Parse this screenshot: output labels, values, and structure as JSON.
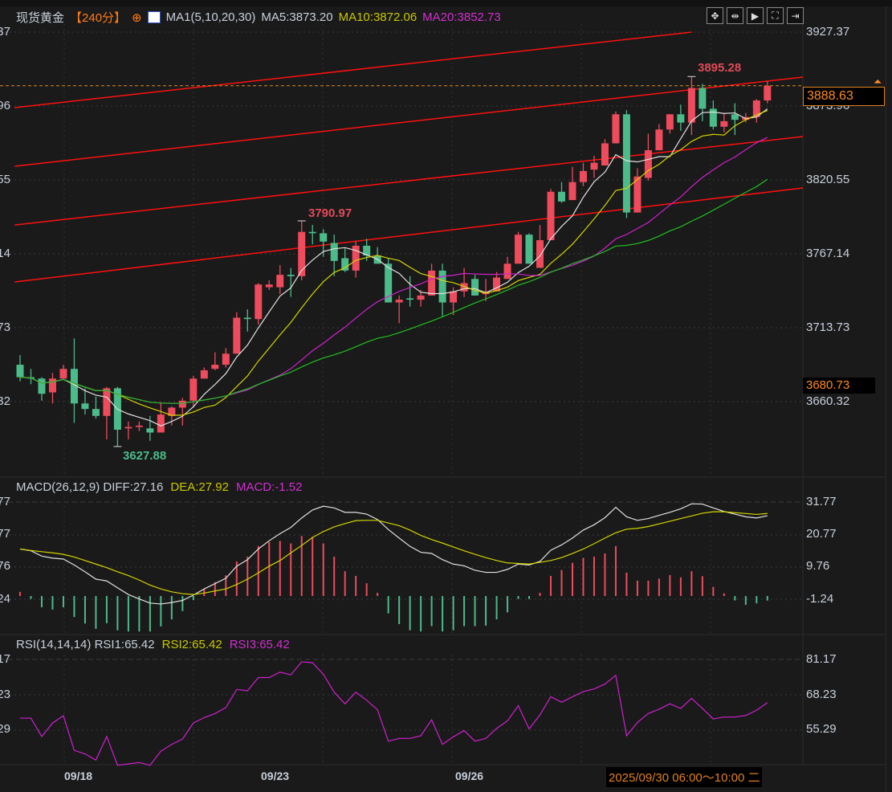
{
  "header": {
    "symbol": "现货黄金",
    "period": "【240分】",
    "ma_label": "MA1(5,10,20,30)",
    "ma5": "MA5:3873.20",
    "ma10": "MA10:3872.06",
    "ma20": "MA20:3852.73"
  },
  "toolbar": [
    {
      "icon": "crosshair-icon",
      "glyph": "✥"
    },
    {
      "icon": "range-icon",
      "glyph": "⇹"
    },
    {
      "icon": "play-icon",
      "glyph": "▶"
    },
    {
      "icon": "fullscreen-icon",
      "glyph": "⛶"
    },
    {
      "icon": "exit-icon",
      "glyph": "⇥"
    }
  ],
  "price_axis": [
    "3927.37",
    "3873.96",
    "3820.55",
    "3767.14",
    "3713.73",
    "3660.32"
  ],
  "current_price": "3888.63",
  "marker_price": "3680.73",
  "annotations": {
    "high": "3895.28",
    "mid_high": "3790.97",
    "low": "3627.88"
  },
  "macd": {
    "title": "MACD(26,12,9)",
    "diff": "DIFF:27.16",
    "dea": "DEA:27.92",
    "macd": "MACD:-1.52",
    "axis": [
      "31.77",
      "20.77",
      "9.76",
      "-1.24"
    ]
  },
  "rsi": {
    "title": "RSI(14,14,14)",
    "rsi1": "RSI1:65.42",
    "rsi2": "RSI2:65.42",
    "rsi3": "RSI3:65.42",
    "axis": [
      "81.17",
      "68.23",
      "55.29"
    ]
  },
  "x_axis": {
    "dates": [
      "09/18",
      "09/23",
      "09/26"
    ],
    "cursor_time": "2025/09/30 06:00～10:00 二"
  },
  "colors": {
    "up": "#ee4b5c",
    "down": "#4cbb8a",
    "trend": "#ff1010",
    "ma5": "#e0e0e0",
    "ma10": "#d4d400",
    "ma20": "#d020d0",
    "ma30": "#20c020",
    "dif": "#e0e0e0",
    "dea": "#d4d400",
    "rsi": "#d020d0"
  },
  "chart_data": {
    "type": "candlestick",
    "title": "现货黄金 240分",
    "ylim": [
      3605,
      3940
    ],
    "candles_ohlc": [
      [
        3687,
        3694,
        3675,
        3678
      ],
      [
        3678,
        3684,
        3673,
        3677
      ],
      [
        3677,
        3678,
        3661,
        3666
      ],
      [
        3667,
        3681,
        3659,
        3677
      ],
      [
        3677,
        3687,
        3677,
        3684
      ],
      [
        3684,
        3706,
        3645,
        3659
      ],
      [
        3659,
        3670,
        3651,
        3655
      ],
      [
        3655,
        3664,
        3648,
        3650
      ],
      [
        3650,
        3671,
        3633,
        3670
      ],
      [
        3670,
        3671,
        3627.88,
        3640
      ],
      [
        3641,
        3646,
        3633,
        3642
      ],
      [
        3642,
        3646,
        3639,
        3643
      ],
      [
        3641,
        3650,
        3632,
        3638
      ],
      [
        3638,
        3660,
        3638,
        3651
      ],
      [
        3650,
        3657,
        3643,
        3656
      ],
      [
        3656,
        3663,
        3643,
        3661
      ],
      [
        3661,
        3679,
        3656,
        3677
      ],
      [
        3677,
        3685,
        3677,
        3683
      ],
      [
        3684,
        3696,
        3683,
        3687
      ],
      [
        3687,
        3699,
        3685,
        3695
      ],
      [
        3695,
        3725,
        3695,
        3721
      ],
      [
        3721,
        3727,
        3711,
        3720
      ],
      [
        3720,
        3746,
        3716,
        3745
      ],
      [
        3743,
        3748,
        3741,
        3745
      ],
      [
        3743,
        3759,
        3738,
        3752
      ],
      [
        3752,
        3757,
        3736,
        3751
      ],
      [
        3751,
        3790.97,
        3748,
        3783
      ],
      [
        3783,
        3788,
        3774,
        3782
      ],
      [
        3782,
        3785,
        3765,
        3776
      ],
      [
        3775,
        3781,
        3751,
        3762
      ],
      [
        3764,
        3771,
        3754,
        3755
      ],
      [
        3755,
        3776,
        3750,
        3773
      ],
      [
        3773,
        3778,
        3762,
        3766
      ],
      [
        3766,
        3772,
        3760,
        3760
      ],
      [
        3760,
        3764,
        3732,
        3732
      ],
      [
        3732,
        3737,
        3717,
        3734
      ],
      [
        3735,
        3751,
        3729,
        3734
      ],
      [
        3734,
        3741,
        3729,
        3737
      ],
      [
        3737,
        3760,
        3737,
        3755
      ],
      [
        3755,
        3760,
        3722,
        3732
      ],
      [
        3732,
        3743,
        3723,
        3740
      ],
      [
        3740,
        3757,
        3736,
        3746
      ],
      [
        3749,
        3752,
        3737,
        3737
      ],
      [
        3738,
        3749,
        3733,
        3740
      ],
      [
        3740,
        3754,
        3740,
        3750
      ],
      [
        3749,
        3765,
        3749,
        3760
      ],
      [
        3760,
        3783,
        3760,
        3781
      ],
      [
        3781,
        3782,
        3760,
        3760
      ],
      [
        3757,
        3788,
        3757,
        3777
      ],
      [
        3777,
        3814,
        3777,
        3812
      ],
      [
        3812,
        3819,
        3804,
        3805
      ],
      [
        3806,
        3830,
        3806,
        3819
      ],
      [
        3819,
        3833,
        3816,
        3827
      ],
      [
        3828,
        3838,
        3822,
        3833
      ],
      [
        3831,
        3850,
        3831,
        3847
      ],
      [
        3847,
        3870,
        3847,
        3868
      ],
      [
        3868,
        3871,
        3793,
        3797
      ],
      [
        3797,
        3829,
        3797,
        3823
      ],
      [
        3822,
        3854,
        3820,
        3842
      ],
      [
        3842,
        3861,
        3842,
        3857
      ],
      [
        3857,
        3868,
        3854,
        3868
      ],
      [
        3868,
        3875,
        3856,
        3862
      ],
      [
        3862,
        3895.28,
        3853,
        3887
      ],
      [
        3887,
        3890,
        3863,
        3872
      ],
      [
        3872,
        3878,
        3857,
        3859
      ],
      [
        3859,
        3869,
        3855,
        3863
      ],
      [
        3868,
        3876,
        3853,
        3864
      ],
      [
        3864,
        3869,
        3862,
        3866
      ],
      [
        3866,
        3879,
        3862,
        3878
      ],
      [
        3878,
        3892,
        3876,
        3888.63
      ]
    ],
    "ma_periods": [
      5,
      10,
      20,
      30
    ],
    "trendlines": [
      [
        [
          -0.5,
          3872.8
        ],
        [
          62,
          3927.37
        ]
      ],
      [
        [
          -0.5,
          3830.4
        ],
        [
          72.3,
          3894.9
        ]
      ],
      [
        [
          -0.5,
          3788.0
        ],
        [
          72.3,
          3851.9
        ]
      ],
      [
        [
          -0.5,
          3746.8
        ],
        [
          72.3,
          3814.8
        ]
      ]
    ],
    "macd_hist": [
      1.4,
      -1.0,
      -3.8,
      -4.6,
      -3.8,
      -7.1,
      -9.3,
      -11.1,
      -9.2,
      -11.6,
      -12,
      -12,
      -12,
      -10.3,
      -7.9,
      -5.1,
      -1.4,
      2.3,
      4.7,
      7.0,
      11.7,
      13.3,
      16.9,
      18.3,
      18.6,
      17.8,
      20.3,
      20.0,
      17.8,
      13.3,
      8.4,
      6.8,
      4.3,
      1.1,
      -5.9,
      -9.5,
      -11.6,
      -12.0,
      -10.2,
      -12.0,
      -11.6,
      -10.2,
      -10.2,
      -10.0,
      -7.9,
      -5.5,
      -1.0,
      -1.0,
      1.1,
      6.8,
      8.8,
      11.2,
      12.9,
      13.3,
      14.4,
      16.9,
      7.9,
      5.2,
      5.2,
      5.9,
      7.1,
      6.3,
      8.4,
      6.7,
      3.1,
      0.9,
      -1.5,
      -3.0,
      -2.5,
      -1.52
    ],
    "diff": [
      15.9,
      15.3,
      13.5,
      12.8,
      12.5,
      10.5,
      8.2,
      5.7,
      5.1,
      2.8,
      0.5,
      -1.0,
      -2.4,
      -2.7,
      -2.2,
      -1.5,
      0.3,
      2.4,
      4.2,
      6.0,
      10.1,
      12.3,
      15.9,
      18.7,
      21.1,
      23.2,
      26.4,
      29.1,
      30.4,
      29.8,
      28.3,
      28.3,
      27.7,
      25.9,
      22.5,
      19.6,
      16.8,
      14.8,
      14.4,
      12.3,
      10.8,
      10.2,
      8.7,
      8.0,
      8.0,
      9.0,
      10.8,
      10.5,
      11.7,
      15.5,
      17.3,
      19.6,
      22.3,
      24.1,
      26.5,
      30.0,
      26.8,
      25.6,
      26.2,
      27.3,
      28.3,
      29.5,
      31.2,
      31.1,
      29.8,
      28.6,
      27.7,
      26.8,
      26.4,
      27.16
    ],
    "dea": [
      15.9,
      15.4,
      15.0,
      14.6,
      14.1,
      13.2,
      12.0,
      10.8,
      9.6,
      8.2,
      6.9,
      5.4,
      3.7,
      2.4,
      1.4,
      0.8,
      0.5,
      1.0,
      1.7,
      2.4,
      3.9,
      5.7,
      7.8,
      10.1,
      12.0,
      14.6,
      17.1,
      19.8,
      21.8,
      23.4,
      24.5,
      25.5,
      25.6,
      25.6,
      24.7,
      23.8,
      22.3,
      20.5,
      19.1,
      17.9,
      16.6,
      15.3,
      14.1,
      13.0,
      12.0,
      11.2,
      11.0,
      10.8,
      11.4,
      12.0,
      13.0,
      14.4,
      15.9,
      17.7,
      19.6,
      21.4,
      22.6,
      22.9,
      23.5,
      24.4,
      25.3,
      26.2,
      27.1,
      28.0,
      28.5,
      28.5,
      28.2,
      27.9,
      27.6,
      27.92
    ],
    "macd_ylim": [
      -13,
      34
    ],
    "rsi": [
      59.7,
      59.7,
      52.9,
      57.9,
      60.6,
      47.8,
      46.5,
      44.2,
      52.9,
      42.3,
      42.8,
      43.3,
      42.3,
      47.5,
      50.0,
      52.0,
      57.9,
      59.9,
      61.4,
      63.6,
      70.3,
      69.8,
      74.7,
      74.7,
      76.7,
      75.7,
      80.5,
      80.2,
      75.9,
      69.3,
      65.0,
      69.3,
      66.3,
      62.8,
      51.2,
      52.2,
      52.2,
      53.2,
      59.1,
      50.0,
      52.8,
      55.1,
      51.2,
      52.2,
      55.9,
      58.7,
      64.3,
      55.7,
      60.9,
      67.6,
      65.6,
      67.6,
      69.5,
      70.5,
      72.3,
      75.5,
      53.2,
      58.1,
      61.4,
      63.0,
      65.0,
      63.3,
      67.0,
      63.3,
      59.4,
      60.1,
      60.1,
      60.7,
      62.6,
      65.42
    ],
    "rsi_ylim": [
      40,
      84
    ],
    "grid": true
  }
}
